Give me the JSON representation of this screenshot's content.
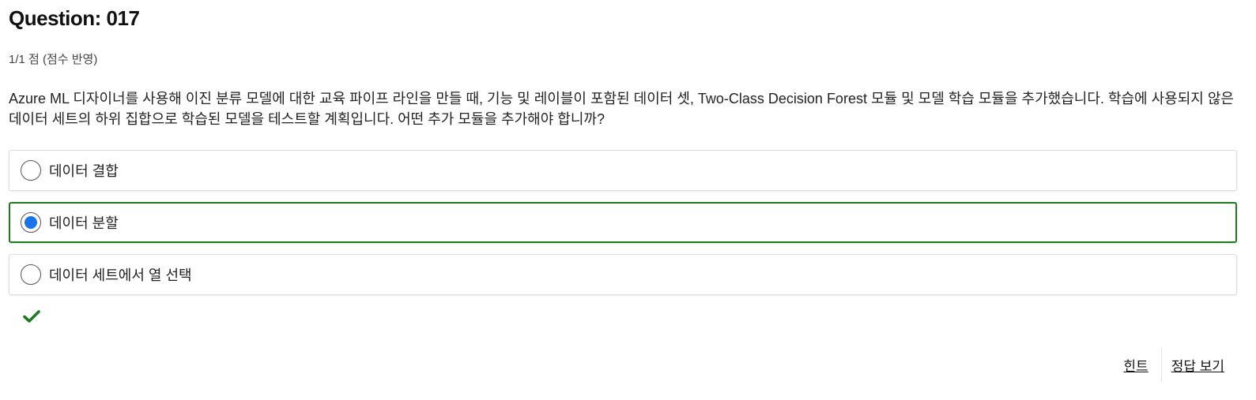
{
  "question": {
    "title": "Question: 017",
    "score": "1/1 점 (점수 반영)",
    "text": "Azure ML 디자이너를 사용해 이진 분류 모델에 대한 교육 파이프 라인을 만들 때, 기능 및 레이블이 포함된 데이터 셋, Two-Class Decision Forest 모듈 및 모델 학습 모듈을 추가했습니다. 학습에 사용되지 않은 데이터 세트의 하위 집합으로 학습된 모델을 테스트할 계획입니다. 어떤 추가 모듈을 추가해야 합니까?"
  },
  "options": [
    {
      "label": "데이터 결합",
      "selected": false
    },
    {
      "label": "데이터 분할",
      "selected": true
    },
    {
      "label": "데이터 세트에서 열 선택",
      "selected": false
    }
  ],
  "result": {
    "icon": "checkmark-icon",
    "color": "#1e7b1e"
  },
  "footer": {
    "hint_label": "힌트",
    "answer_label": "정답 보기"
  },
  "colors": {
    "selected_border": "#1e7b1e",
    "radio_fill": "#1a73e8"
  }
}
